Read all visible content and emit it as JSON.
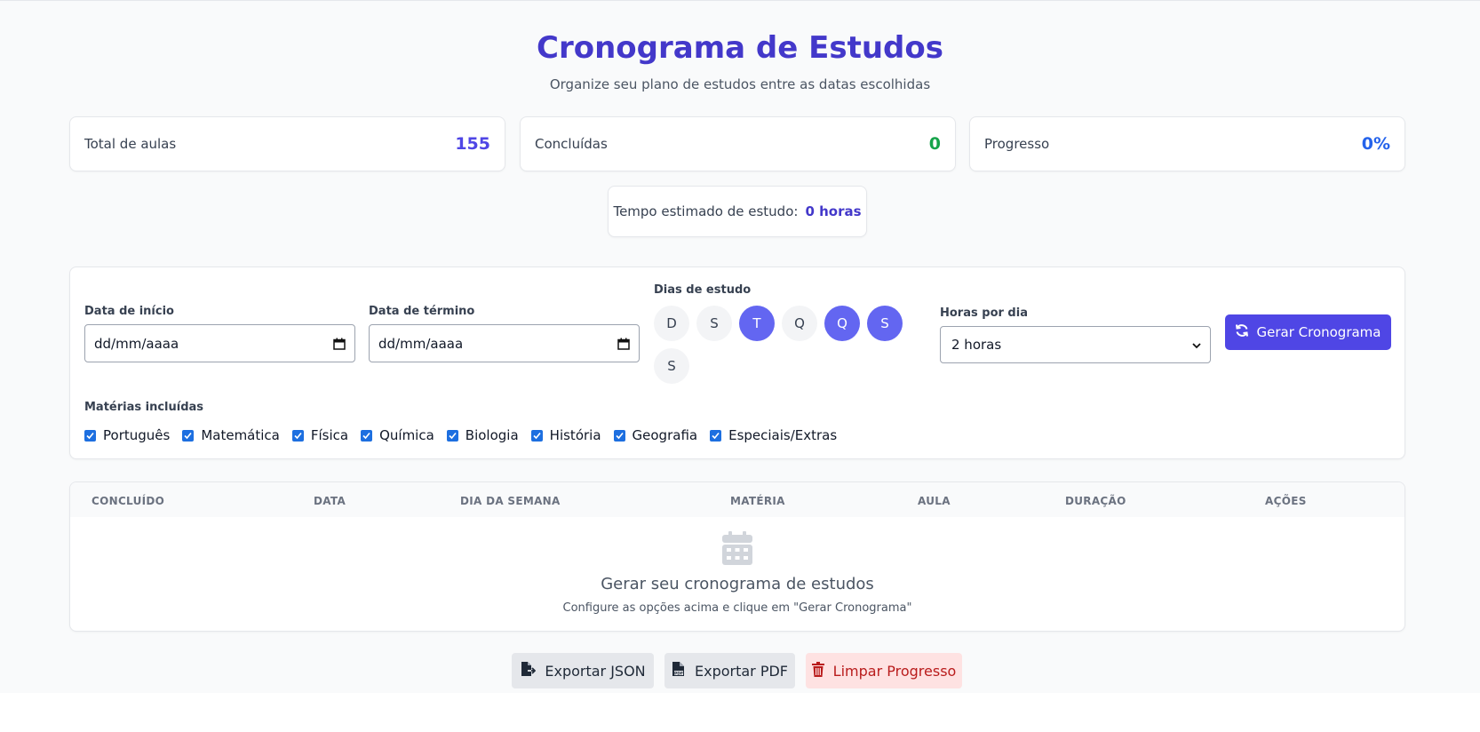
{
  "header": {
    "title": "Cronograma de Estudos",
    "subtitle": "Organize seu plano de estudos entre as datas escolhidas"
  },
  "stats": [
    {
      "label": "Total de aulas",
      "value": "155",
      "color": "#4f46e5"
    },
    {
      "label": "Concluídas",
      "value": "0",
      "color": "#16a34a"
    },
    {
      "label": "Progresso",
      "value": "0%",
      "color": "#2563eb"
    }
  ],
  "time": {
    "label": "Tempo estimado de estudo:",
    "value": "0 horas"
  },
  "config": {
    "start_label": "Data de início",
    "start_value": "dd/mm/aaaa",
    "end_label": "Data de término",
    "end_value": "dd/mm/aaaa",
    "days_label": "Dias de estudo",
    "days": [
      {
        "letter": "D",
        "selected": false
      },
      {
        "letter": "S",
        "selected": false
      },
      {
        "letter": "T",
        "selected": true
      },
      {
        "letter": "Q",
        "selected": false
      },
      {
        "letter": "Q",
        "selected": true
      },
      {
        "letter": "S",
        "selected": true
      },
      {
        "letter": "S",
        "selected": false
      }
    ],
    "hours_label": "Horas por dia",
    "hours_value": "2 horas",
    "generate_label": "Gerar Cronograma",
    "subjects_label": "Matérias incluídas",
    "subjects": [
      "Português",
      "Matemática",
      "Física",
      "Química",
      "Biologia",
      "História",
      "Geografia",
      "Especiais/Extras"
    ]
  },
  "table": {
    "columns": [
      "CONCLUÍDO",
      "DATA",
      "DIA DA SEMANA",
      "MATÉRIA",
      "AULA",
      "DURAÇÃO",
      "AÇÕES"
    ],
    "empty_title": "Gerar seu cronograma de estudos",
    "empty_subtitle": "Configure as opções acima e clique em \"Gerar Cronograma\""
  },
  "actions": {
    "export_json": "Exportar JSON",
    "export_pdf": "Exportar PDF",
    "clear": "Limpar Progresso"
  },
  "colors": {
    "accent": "#4f46e5",
    "day_selected": "#6366f1",
    "title": "#4338ca"
  }
}
